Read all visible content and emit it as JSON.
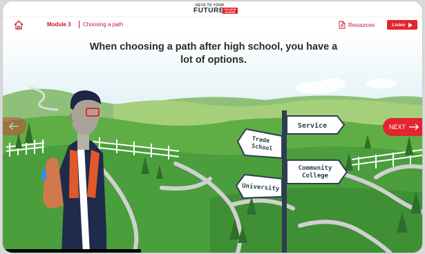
{
  "logo": {
    "line1": "KEYS TO YOUR",
    "line2": "FUTURE",
    "tag_line1": "COLLEGE",
    "tag_line2": "ACCESS"
  },
  "nav": {
    "module": "Module 3",
    "section": "Choosing a path",
    "resources_label": "Resources",
    "listen_label": "Listen"
  },
  "slide": {
    "headline_line1": "When choosing a path after high school, you have a",
    "headline_line2": "lot of options."
  },
  "signpost": {
    "top": "Service",
    "left": [
      "Trade",
      "School"
    ],
    "right": [
      "Community",
      "College"
    ],
    "bottom": "University"
  },
  "navigation": {
    "next_label": "NEXT"
  },
  "caption": "",
  "colors": {
    "accent": "#e4252e",
    "sky": "#a9d9e6",
    "grass": "#4a9e3c"
  },
  "icons": [
    "home-icon",
    "document-icon",
    "play-icon",
    "arrow-left-icon",
    "arrow-right-icon"
  ]
}
